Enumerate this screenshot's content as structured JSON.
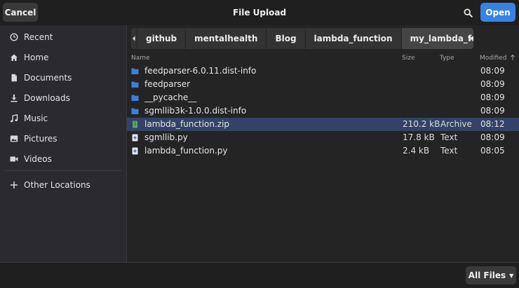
{
  "header": {
    "cancel_label": "Cancel",
    "title": "File Upload",
    "open_label": "Open"
  },
  "sidebar": {
    "items": [
      {
        "label": "Recent",
        "icon": "clock-icon"
      },
      {
        "label": "Home",
        "icon": "home-icon"
      },
      {
        "label": "Documents",
        "icon": "document-icon"
      },
      {
        "label": "Downloads",
        "icon": "download-icon"
      },
      {
        "label": "Music",
        "icon": "music-icon"
      },
      {
        "label": "Pictures",
        "icon": "picture-icon"
      },
      {
        "label": "Videos",
        "icon": "video-icon"
      },
      {
        "label": "Other Locations",
        "icon": "plus-icon"
      }
    ]
  },
  "pathbar": {
    "crumbs": [
      "github",
      "mentalhealth",
      "Blog",
      "lambda_function",
      "my_lambda_function"
    ],
    "active_index": 4
  },
  "columns": {
    "name": "Name",
    "size": "Size",
    "type": "Type",
    "modified": "Modified"
  },
  "files": [
    {
      "name": "feedparser-6.0.11.dist-info",
      "size": "",
      "type": "",
      "modified": "08:09",
      "kind": "folder"
    },
    {
      "name": "feedparser",
      "size": "",
      "type": "",
      "modified": "08:09",
      "kind": "folder"
    },
    {
      "name": "__pycache__",
      "size": "",
      "type": "",
      "modified": "08:09",
      "kind": "folder"
    },
    {
      "name": "sgmllib3k-1.0.0.dist-info",
      "size": "",
      "type": "",
      "modified": "08:09",
      "kind": "folder"
    },
    {
      "name": "lambda_function.zip",
      "size": "210.2 kB",
      "type": "Archive",
      "modified": "08:12",
      "kind": "archive",
      "selected": true
    },
    {
      "name": "sgmllib.py",
      "size": "17.8 kB",
      "type": "Text",
      "modified": "08:09",
      "kind": "text"
    },
    {
      "name": "lambda_function.py",
      "size": "2.4 kB",
      "type": "Text",
      "modified": "08:05",
      "kind": "text"
    }
  ],
  "footer": {
    "filter_label": "All Files"
  },
  "colors": {
    "accent": "#3584e4",
    "selection": "#334266",
    "folder": "#3d7ee0"
  }
}
